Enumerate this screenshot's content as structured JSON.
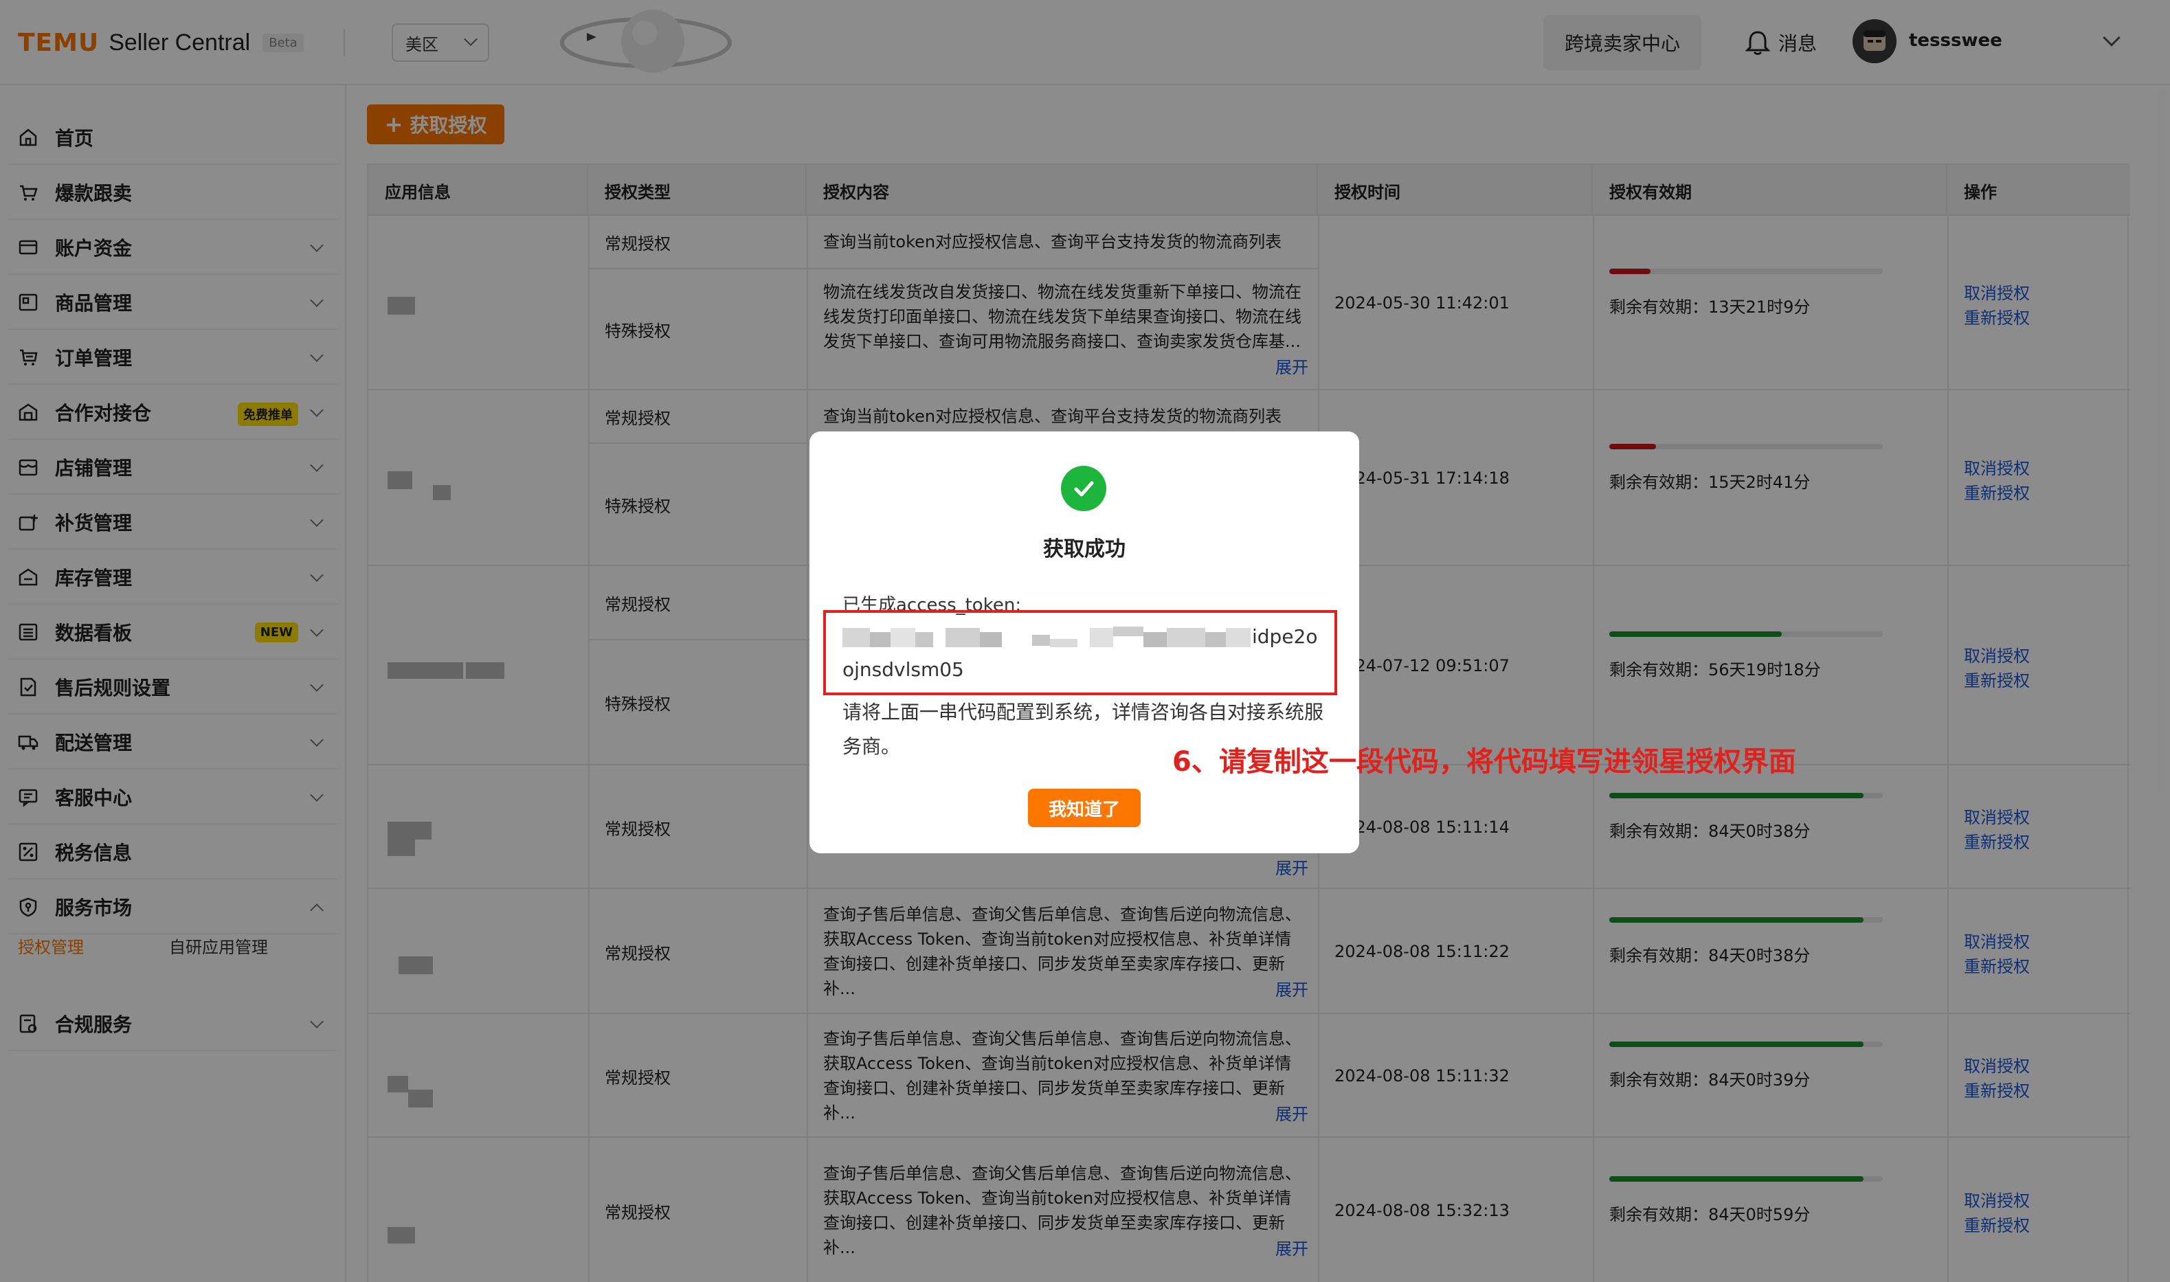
{
  "header": {
    "logo_brand": "TEMU",
    "logo_product": "Seller Central",
    "logo_badge": "Beta",
    "region": "美区",
    "cross_border_button": "跨境卖家中心",
    "messages": "消息",
    "username": "tessswee"
  },
  "sidebar": {
    "items": [
      {
        "label": "首页",
        "icon": "home-icon"
      },
      {
        "label": "爆款跟卖",
        "icon": "cart-icon"
      },
      {
        "label": "账户资金",
        "icon": "wallet-icon"
      },
      {
        "label": "商品管理",
        "icon": "product-icon"
      },
      {
        "label": "订单管理",
        "icon": "order-cart-icon"
      },
      {
        "label": "合作对接仓",
        "icon": "warehouse-icon",
        "badge": "免费推单"
      },
      {
        "label": "店铺管理",
        "icon": "store-icon"
      },
      {
        "label": "补货管理",
        "icon": "restock-icon"
      },
      {
        "label": "库存管理",
        "icon": "inventory-icon"
      },
      {
        "label": "数据看板",
        "icon": "dashboard-icon",
        "badge": "NEW"
      },
      {
        "label": "售后规则设置",
        "icon": "rules-icon"
      },
      {
        "label": "配送管理",
        "icon": "truck-icon"
      },
      {
        "label": "客服中心",
        "icon": "service-icon"
      },
      {
        "label": "税务信息",
        "icon": "tax-icon"
      },
      {
        "label": "服务市场",
        "icon": "shield-icon"
      },
      {
        "label": "合规服务",
        "icon": "compliance-icon"
      }
    ],
    "sub_items": [
      "授权管理",
      "自研应用管理"
    ]
  },
  "main": {
    "get_auth_button": "获取授权",
    "columns": [
      "应用信息",
      "授权类型",
      "授权内容",
      "授权时间",
      "授权有效期",
      "操作"
    ],
    "expand_label": "展开",
    "cancel_label": "取消授权",
    "reauth_label": "重新授权",
    "rows": [
      {
        "subs": [
          {
            "type": "常规授权",
            "content": "查询当前token对应授权信息、查询平台支持发货的物流商列表"
          },
          {
            "type": "特殊授权",
            "content": "物流在线发货改自发货接口、物流在线发货重新下单接口、物流在线发货打印面单接口、物流在线发货下单结果查询接口、物流在线发货下单接口、查询可用物流服务商接口、查询卖家发货仓库基...",
            "expand": true
          }
        ],
        "time": "2024-05-30 11:42:01",
        "remain": "剩余有效期：13天21时9分",
        "progress": 0.15,
        "color": "#c8161d"
      },
      {
        "subs": [
          {
            "type": "常规授权",
            "content": "查询当前token对应授权信息、查询平台支持发货的物流商列表"
          },
          {
            "type": "特殊授权",
            "content": ""
          }
        ],
        "time": "2024-05-31 17:14:18",
        "remain": "剩余有效期：15天2时41分",
        "progress": 0.17,
        "color": "#c8161d"
      },
      {
        "subs": [
          {
            "type": "常规授权",
            "content": ""
          },
          {
            "type": "特殊授权",
            "content": ""
          }
        ],
        "time": "2024-07-12 09:51:07",
        "remain": "剩余有效期：56天19时18分",
        "progress": 0.63,
        "color": "#1a8a2e"
      },
      {
        "subs": [
          {
            "type": "常规授权",
            "content": "",
            "expand": true
          }
        ],
        "time": "2024-08-08 15:11:14",
        "remain": "剩余有效期：84天0时38分",
        "progress": 0.93,
        "color": "#1a8a2e"
      },
      {
        "subs": [
          {
            "type": "常规授权",
            "content": "查询子售后单信息、查询父售后单信息、查询售后逆向物流信息、获取Access Token、查询当前token对应授权信息、补货单详情查询接口、创建补货单接口、同步发货单至卖家库存接口、更新补...",
            "expand": true
          }
        ],
        "time": "2024-08-08 15:11:22",
        "remain": "剩余有效期：84天0时38分",
        "progress": 0.93,
        "color": "#1a8a2e"
      },
      {
        "subs": [
          {
            "type": "常规授权",
            "content": "查询子售后单信息、查询父售后单信息、查询售后逆向物流信息、获取Access Token、查询当前token对应授权信息、补货单详情查询接口、创建补货单接口、同步发货单至卖家库存接口、更新补...",
            "expand": true
          }
        ],
        "time": "2024-08-08 15:11:32",
        "remain": "剩余有效期：84天0时39分",
        "progress": 0.93,
        "color": "#1a8a2e"
      },
      {
        "subs": [
          {
            "type": "常规授权",
            "content": "查询子售后单信息、查询父售后单信息、查询售后逆向物流信息、获取Access Token、查询当前token对应授权信息、补货单详情查询接口、创建补货单接口、同步发货单至卖家库存接口、更新补...",
            "expand": true
          }
        ],
        "time": "2024-08-08 15:32:13",
        "remain": "剩余有效期：84天0时59分",
        "progress": 0.93,
        "color": "#1a8a2e"
      }
    ]
  },
  "modal": {
    "title": "获取成功",
    "token_label": "已生成access_token:",
    "token_visible_end": "idpe2o",
    "token_line2": "ojnsdvlsm05",
    "hint": "请将上面一串代码配置到系统，详情咨询各自对接系统服务商。",
    "ok_button": "我知道了"
  },
  "annotation": "6、请复制这一段代码，将代码填写进领星授权界面",
  "colors": {
    "accent": "#fb7701",
    "link": "#1a56d6",
    "annotation": "#e0221e",
    "success": "#1db53c"
  }
}
